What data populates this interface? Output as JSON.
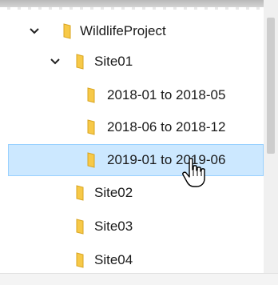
{
  "tree": {
    "items": [
      {
        "label": "WildlifeProject",
        "expanded": true,
        "selected": false
      },
      {
        "label": "Site01",
        "expanded": true,
        "selected": false
      },
      {
        "label": "2018-01 to 2018-05",
        "expanded": null,
        "selected": false
      },
      {
        "label": "2018-06 to 2018-12",
        "expanded": null,
        "selected": false
      },
      {
        "label": "2019-01 to 2019-06",
        "expanded": null,
        "selected": true
      },
      {
        "label": "Site02",
        "expanded": null,
        "selected": false
      },
      {
        "label": "Site03",
        "expanded": null,
        "selected": false
      },
      {
        "label": "Site04",
        "expanded": null,
        "selected": false
      }
    ]
  },
  "icons": {
    "expand": "chevron-down-icon",
    "folder": "folder-icon",
    "cursor": "hand-pointer-icon"
  },
  "colors": {
    "folder": "#f7c948",
    "selection_bg": "#cce8ff",
    "selection_border": "#99d1ff"
  }
}
